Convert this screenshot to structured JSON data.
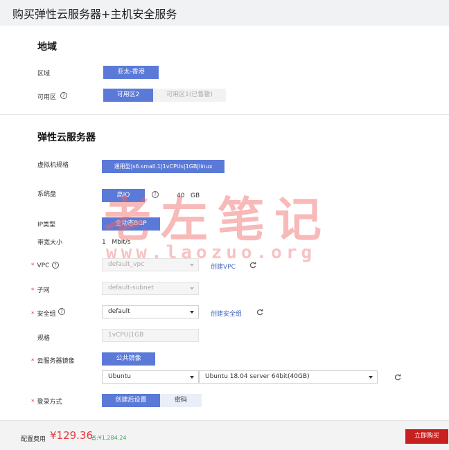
{
  "page": {
    "title": "购买弹性云服务器+主机安全服务"
  },
  "region_section": {
    "title": "地域",
    "region_label": "区域",
    "region_value": "亚太-香港",
    "az_label": "可用区",
    "az_selected": "可用区2",
    "az_other": "可用区1(已售罄)"
  },
  "ecs_section": {
    "title": "弹性云服务器",
    "flavor_label": "虚拟机规格",
    "flavor_value": "通用型|s6.small.1|1vCPUs|1GB|linux",
    "disk_label": "系统盘",
    "disk_type": "高IO",
    "disk_size": "40",
    "disk_unit": "GB",
    "ip_label": "IP类型",
    "ip_value": "全动态BGP",
    "bandwidth_label": "带宽大小",
    "bandwidth_value": "1",
    "bandwidth_unit": "Mbit/s",
    "vpc_label": "VPC",
    "vpc_value": "default_vpc",
    "vpc_create": "创建VPC",
    "subnet_label": "子网",
    "subnet_value": "default-subnet",
    "sg_label": "安全组",
    "sg_value": "default",
    "sg_create": "创建安全组",
    "spec_label": "规格",
    "spec_value": "1vCPU|1GB",
    "image_label": "云服务器镜像",
    "image_type": "公共镜像",
    "os_value": "Ubuntu",
    "os_version": "Ubuntu 18.04 server 64bit(40GB)",
    "login_label": "登录方式",
    "login_selected": "创建后设置",
    "login_other": "密码"
  },
  "icons": {
    "help": "help-circle-icon",
    "refresh": "refresh-icon",
    "dropdown": "chevron-down-icon"
  },
  "watermark": {
    "text": "老左笔记",
    "url": "www.laozuo.org"
  },
  "footer": {
    "fee_label": "配置费用",
    "price": "¥129.36",
    "save": "省:¥1,284.24",
    "buy_label": "立即购买"
  },
  "colors": {
    "accent": "#5b7ad8",
    "buy": "#c7201e",
    "price": "#e4393c",
    "save": "#2eab5a",
    "link": "#4668c5"
  }
}
